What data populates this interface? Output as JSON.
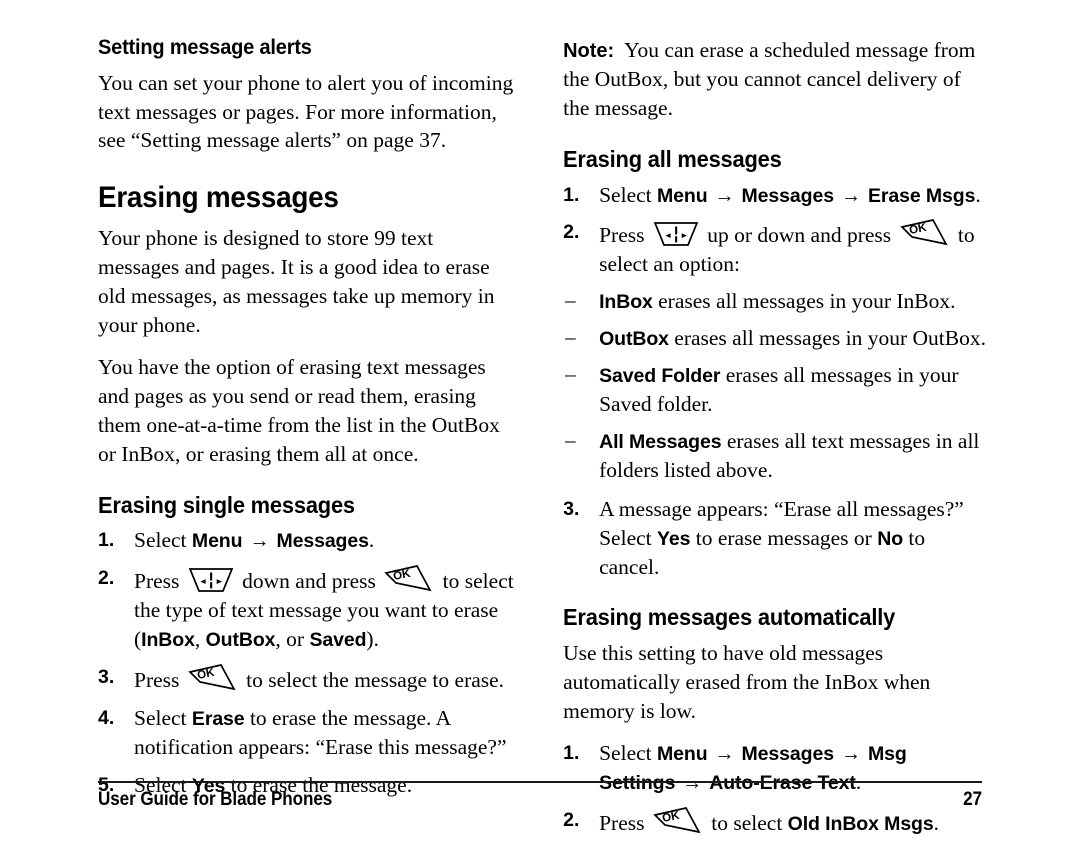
{
  "document": {
    "footer_title": "User Guide for Blade Phones",
    "page_number": "27"
  },
  "icons": {
    "nav_key": "navigation-key-icon",
    "ok_key": "ok-key-icon",
    "arrow": "→",
    "dash": "–"
  },
  "left_column": {
    "section_setting_alerts": {
      "heading": "Setting message alerts",
      "paragraph": "You can set your phone to alert you of incoming text messages or pages. For more information, see “Setting message alerts” on page 37."
    },
    "section_erasing_messages": {
      "heading": "Erasing messages",
      "paragraph_1": "Your phone is designed to store 99 text messages and pages. It is a good idea to erase old messages, as messages take up memory in your phone.",
      "paragraph_2": "You have the option of erasing text messages and pages as you send or read them, erasing them one-at-a-time from the list in the OutBox or InBox, or erasing them all at once."
    },
    "section_erasing_single": {
      "heading": "Erasing single messages",
      "steps": [
        {
          "number": "1.",
          "parts": [
            {
              "type": "text",
              "value": "Select "
            },
            {
              "type": "ui",
              "value": "Menu"
            },
            {
              "type": "arrow"
            },
            {
              "type": "ui",
              "value": "Messages"
            },
            {
              "type": "text",
              "value": "."
            }
          ]
        },
        {
          "number": "2.",
          "parts": [
            {
              "type": "text",
              "value": "Press "
            },
            {
              "type": "nav_key"
            },
            {
              "type": "text",
              "value": " down and press "
            },
            {
              "type": "ok_key"
            },
            {
              "type": "text",
              "value": " to select the type of text message you want to erase ("
            },
            {
              "type": "ui",
              "value": "InBox"
            },
            {
              "type": "text",
              "value": ", "
            },
            {
              "type": "ui",
              "value": "OutBox"
            },
            {
              "type": "text",
              "value": ", or "
            },
            {
              "type": "ui",
              "value": "Saved"
            },
            {
              "type": "text",
              "value": ")."
            }
          ]
        },
        {
          "number": "3.",
          "parts": [
            {
              "type": "text",
              "value": "Press "
            },
            {
              "type": "ok_key"
            },
            {
              "type": "text",
              "value": " to select the message to erase."
            }
          ]
        },
        {
          "number": "4.",
          "parts": [
            {
              "type": "text",
              "value": "Select "
            },
            {
              "type": "ui",
              "value": "Erase"
            },
            {
              "type": "text",
              "value": " to erase the message. A notification appears: “Erase this message?”"
            }
          ]
        },
        {
          "number": "5.",
          "parts": [
            {
              "type": "text",
              "value": "Select "
            },
            {
              "type": "ui",
              "value": "Yes"
            },
            {
              "type": "text",
              "value": " to erase the message."
            }
          ]
        }
      ]
    }
  },
  "right_column": {
    "note": {
      "label": "Note:",
      "text": "You can erase a scheduled message from the OutBox, but you cannot cancel delivery of the message."
    },
    "section_erasing_all": {
      "heading": "Erasing all messages",
      "steps": [
        {
          "number": "1.",
          "parts": [
            {
              "type": "text",
              "value": "Select "
            },
            {
              "type": "ui",
              "value": "Menu"
            },
            {
              "type": "arrow"
            },
            {
              "type": "ui",
              "value": "Messages"
            },
            {
              "type": "arrow"
            },
            {
              "type": "ui",
              "value": "Erase Msgs"
            },
            {
              "type": "text",
              "value": "."
            }
          ]
        },
        {
          "number": "2.",
          "parts": [
            {
              "type": "text",
              "value": "Press "
            },
            {
              "type": "nav_key"
            },
            {
              "type": "text",
              "value": " up or down and press "
            },
            {
              "type": "ok_key"
            },
            {
              "type": "text",
              "value": " to select an option:"
            }
          ]
        }
      ],
      "options": [
        {
          "parts": [
            {
              "type": "ui",
              "value": "InBox"
            },
            {
              "type": "text",
              "value": " erases all messages in your InBox."
            }
          ]
        },
        {
          "parts": [
            {
              "type": "ui",
              "value": "OutBox"
            },
            {
              "type": "text",
              "value": " erases all messages in your OutBox."
            }
          ]
        },
        {
          "parts": [
            {
              "type": "ui",
              "value": "Saved Folder"
            },
            {
              "type": "text",
              "value": " erases all messages in your Saved folder."
            }
          ]
        },
        {
          "parts": [
            {
              "type": "ui",
              "value": "All Messages"
            },
            {
              "type": "text",
              "value": " erases all text messages in all folders listed above."
            }
          ]
        }
      ],
      "final_step": {
        "number": "3.",
        "parts": [
          {
            "type": "text",
            "value": "A message appears: “Erase all messages?” Select "
          },
          {
            "type": "ui",
            "value": "Yes"
          },
          {
            "type": "text",
            "value": " to erase messages or "
          },
          {
            "type": "ui",
            "value": "No"
          },
          {
            "type": "text",
            "value": " to cancel."
          }
        ]
      }
    },
    "section_erasing_auto": {
      "heading": "Erasing messages automatically",
      "paragraph": "Use this setting to have old messages automatically erased from the InBox when memory is low.",
      "steps": [
        {
          "number": "1.",
          "parts": [
            {
              "type": "text",
              "value": "Select "
            },
            {
              "type": "ui",
              "value": "Menu"
            },
            {
              "type": "arrow"
            },
            {
              "type": "ui",
              "value": "Messages"
            },
            {
              "type": "arrow"
            },
            {
              "type": "ui",
              "value": "Msg Settings"
            },
            {
              "type": "arrow"
            },
            {
              "type": "ui",
              "value": "Auto-Erase Text"
            },
            {
              "type": "text",
              "value": "."
            }
          ]
        },
        {
          "number": "2.",
          "parts": [
            {
              "type": "text",
              "value": "Press "
            },
            {
              "type": "ok_key"
            },
            {
              "type": "text",
              "value": " to select "
            },
            {
              "type": "ui",
              "value": "Old InBox Msgs"
            },
            {
              "type": "text",
              "value": "."
            }
          ]
        }
      ]
    }
  }
}
